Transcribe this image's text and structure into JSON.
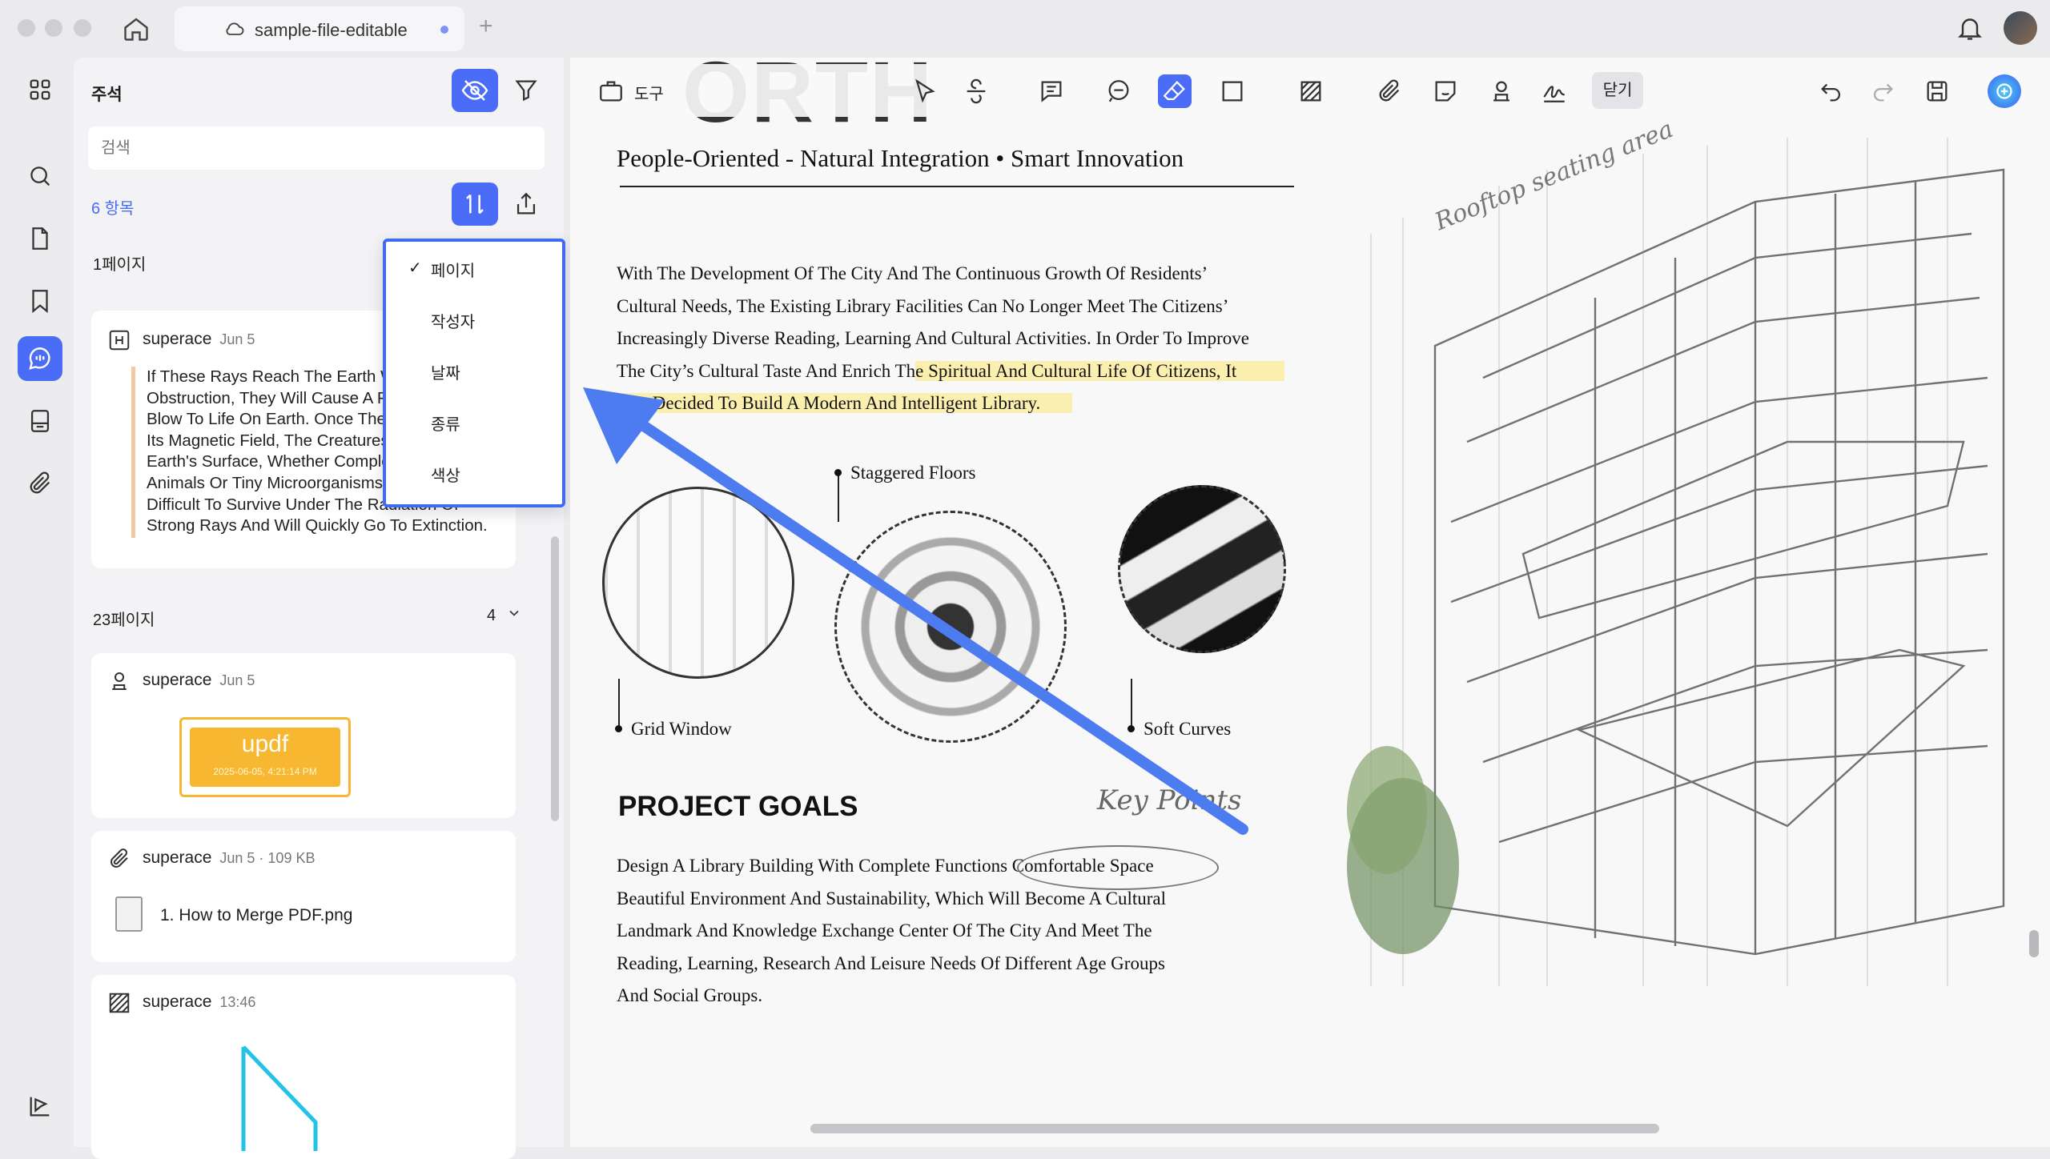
{
  "window": {
    "tab_title": "sample-file-editable"
  },
  "sidebar": {
    "title": "주석",
    "search_placeholder": "검색",
    "item_count": "6 항목",
    "groups": [
      {
        "page_label": "1페이지"
      },
      {
        "page_label": "23페이지",
        "count": "4"
      }
    ],
    "cards": [
      {
        "author": "superace",
        "date": "Jun 5",
        "text": "If These Rays Reach The Earth Without\nObstruction, They Will Cause A Fatal\nBlow To Life On Earth. Once The Earth Loses\nIts Magnetic Field, The Creatures On The\nEarth's Surface, Whether Complex Higher\nAnimals Or Tiny Microorganisms, Will Find It\nDifficult To Survive Under The Radiation Of\nStrong Rays And Will Quickly Go To Extinction."
      },
      {
        "author": "superace",
        "date": "Jun 5",
        "stamp_text": "updf",
        "stamp_sub": "2025-06-05, 4:21:14 PM"
      },
      {
        "author": "superace",
        "date": "Jun 5 · 109 KB",
        "file_name": "1. How to Merge PDF.png"
      },
      {
        "author": "superace",
        "date": "13:46"
      }
    ]
  },
  "sort_menu": {
    "items": [
      "페이지",
      "작성자",
      "날짜",
      "종류",
      "색상"
    ],
    "selected": "페이지",
    "check": "✓"
  },
  "toolbar": {
    "tools_label": "도구",
    "close_label": "닫기"
  },
  "document": {
    "banner_fragment": "ORTH",
    "subtitle": "People-Oriented - Natural Integration • Smart Innovation",
    "para1_lines": [
      "With The Development Of The City And The Continuous Growth Of Residents’",
      "Cultural Needs, The Existing Library Facilities Can No Longer Meet The Citizens’",
      "Increasingly Diverse Reading, Learning And Cultural Activities. In Order To Improve"
    ],
    "para1_line4_plain": "The City’s Cultural Taste And Enrich Th",
    "para1_line4_hl": "e Spiritual And Cultural Life Of Citizens, It",
    "para1_line5_hl": "Was Decided To Build A Modern And Intelligent Library.",
    "label_staggered": "Staggered Floors",
    "label_grid": "Grid Window",
    "label_curves": "Soft Curves",
    "goals_title": "PROJECT GOALS",
    "goals_lines": [
      "Design A Library Building With Complete Functions Comfortable Space",
      "Beautiful Environment And Sustainability, Which Will Become A Cultural",
      "Landmark And Knowledge Exchange Center Of The City And Meet The",
      "Reading, Learning, Research And Leisure Needs Of Different Age Groups",
      "And Social Groups."
    ],
    "handwritten_rooftop": "Rooftop seating area",
    "handwritten_keypoints": "Key Points"
  },
  "colors": {
    "accent": "#4a6cf7",
    "arrow": "#4c7cf0",
    "highlight": "#fbefb0",
    "stamp": "#f7b731"
  }
}
